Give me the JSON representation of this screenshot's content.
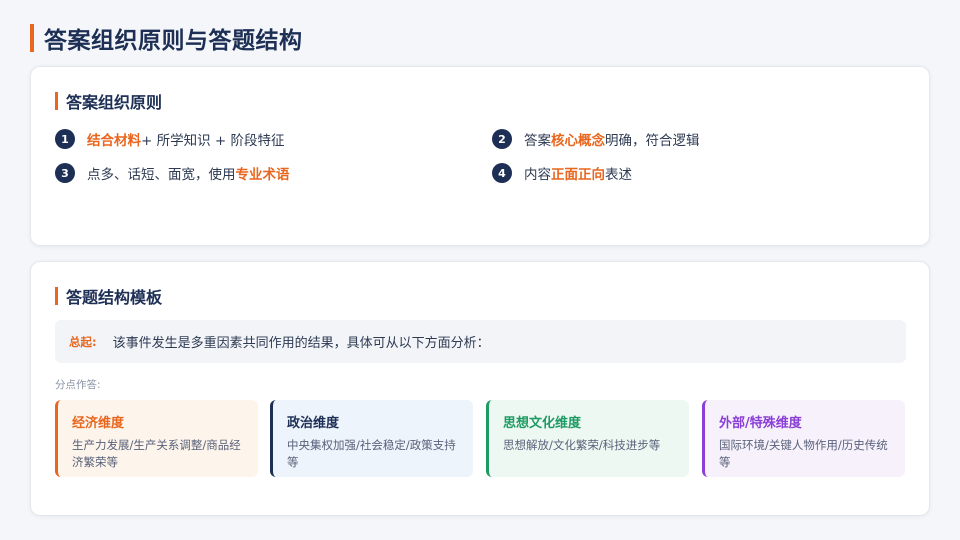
{
  "title": "答案组织原则与答题结构",
  "principles": {
    "heading": "答案组织原则",
    "items": [
      {
        "num": "1",
        "pre": "",
        "hl": "结合材料",
        "post": "+ 所学知识 + 阶段特征"
      },
      {
        "num": "2",
        "pre": "答案",
        "hl": "核心概念",
        "post": "明确，符合逻辑"
      },
      {
        "num": "3",
        "pre": "点多、话短、面宽，使用",
        "hl": "专业术语",
        "post": ""
      },
      {
        "num": "4",
        "pre": "内容",
        "hl": "正面正向",
        "post": "表述"
      }
    ]
  },
  "template": {
    "heading": "答题结构模板",
    "summary_label": "总起:",
    "summary_text": "该事件发生是多重因素共同作用的结果，具体可从以下方面分析：",
    "sub_label": "分点作答:",
    "dimensions": [
      {
        "title": "经济维度",
        "desc": "生产力发展/生产关系调整/商品经济繁荣等"
      },
      {
        "title": "政治维度",
        "desc": "中央集权加强/社会稳定/政策支持等"
      },
      {
        "title": "思想文化维度",
        "desc": "思想解放/文化繁荣/科技进步等"
      },
      {
        "title": "外部/特殊维度",
        "desc": "国际环境/关键人物作用/历史传统等"
      }
    ]
  },
  "colors": {
    "accent": "#e8661e",
    "navy": "#1d2f55",
    "green": "#1e9b62",
    "purple": "#8a3fd6"
  }
}
